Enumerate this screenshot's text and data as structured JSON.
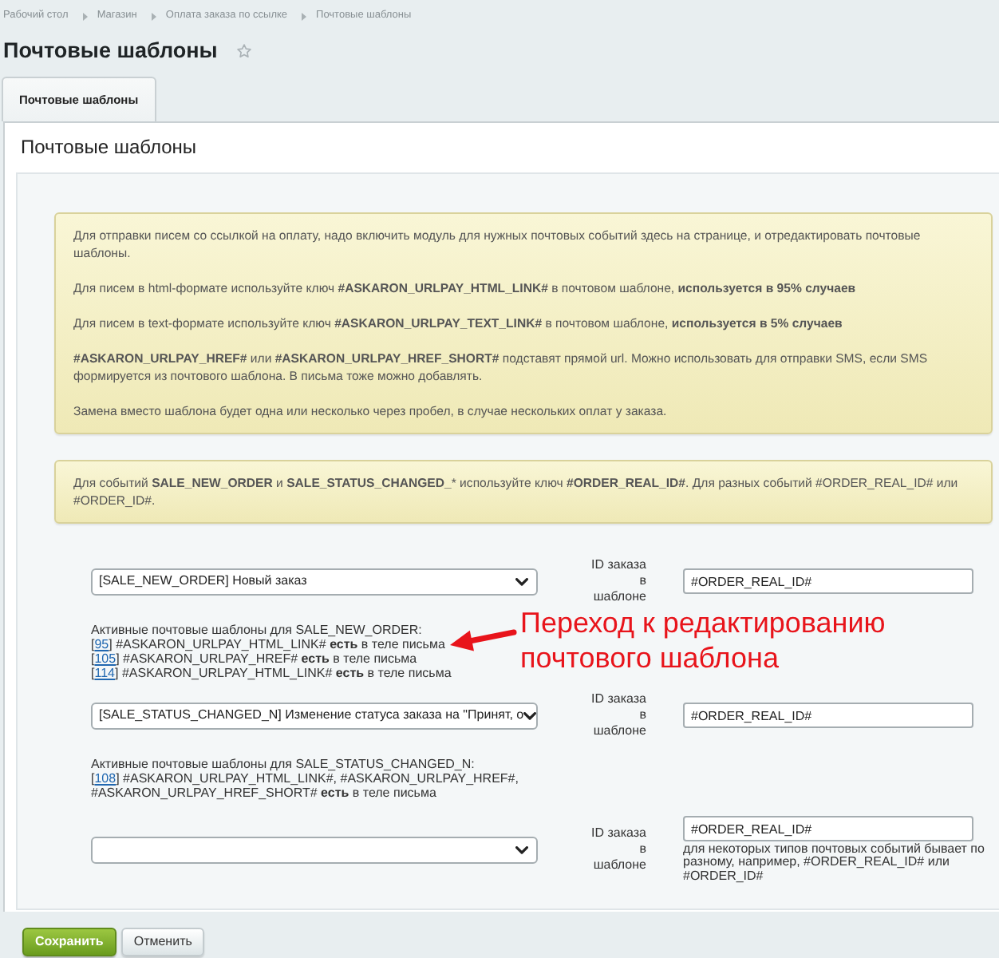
{
  "breadcrumbs": [
    "Рабочий стол",
    "Магазин",
    "Оплата заказа по ссылке",
    "Почтовые шаблоны"
  ],
  "title": "Почтовые шаблоны",
  "tabs": [
    {
      "label": "Почтовые шаблоны",
      "selected": true
    }
  ],
  "section_title": "Почтовые шаблоны",
  "notes": [
    {
      "paragraphs": [
        "Для отправки писем со ссылкой на оплату, надо включить модуль для нужных почтовых событий здесь на странице, и отредактировать почтовые шаблоны.",
        "Для писем в html-формате используйте ключ **#ASKARON_URLPAY_HTML_LINK#** в почтовом шаблоне, **используется в 95% случаев**",
        "Для писем в text-формате используйте ключ **#ASKARON_URLPAY_TEXT_LINK#** в почтовом шаблоне, **используется в 5% случаев**",
        "**#ASKARON_URLPAY_HREF#** или **#ASKARON_URLPAY_HREF_SHORT#** подставят прямой url. Можно использовать для отправки SMS, если SMS формируется из почтового шаблона. В письма тоже можно добавлять.",
        "Замена вместо шаблона будет одна или несколько через пробел, в случае нескольких оплат у заказа."
      ]
    },
    {
      "paragraphs": [
        "Для событий **SALE_NEW_ORDER** и **SALE_STATUS_CHANGED_*** используйте ключ **#ORDER_REAL_ID#**. Для разных событий #ORDER_REAL_ID# или #ORDER_ID#."
      ]
    }
  ],
  "events": [
    {
      "select_value": "[SALE_NEW_ORDER] Новый заказ",
      "id_label": "ID заказа в шаблоне",
      "id_value": "#ORDER_REAL_ID#",
      "active_title": "Активные почтовые шаблоны для SALE_NEW_ORDER:",
      "templates": [
        {
          "before": "[",
          "link": "95",
          "after": "] #ASKARON_URLPAY_HTML_LINK# **есть** в теле письма"
        },
        {
          "before": "[",
          "link": "105",
          "after": "] #ASKARON_URLPAY_HREF# **есть** в теле письма"
        },
        {
          "before": "[",
          "link": "114",
          "after": "] #ASKARON_URLPAY_HTML_LINK# **есть** в теле письма"
        }
      ]
    },
    {
      "select_value": "[SALE_STATUS_CHANGED_N] Изменение статуса заказа на \"Принят, о",
      "id_label": "ID заказа в шаблоне",
      "id_value": "#ORDER_REAL_ID#",
      "active_title": "Активные почтовые шаблоны для SALE_STATUS_CHANGED_N:",
      "templates": [
        {
          "before": "[",
          "link": "108",
          "after": "] #ASKARON_URLPAY_HTML_LINK#, #ASKARON_URLPAY_HREF#, #ASKARON_URLPAY_HREF_SHORT# **есть** в теле письма"
        }
      ]
    },
    {
      "id_label": "ID заказа в шаблоне",
      "id_value": "#ORDER_REAL_ID#",
      "hint": "для некоторых типов почтовых событий бывает по разному, например, #ORDER_REAL_ID# или #ORDER_ID#"
    }
  ],
  "annotation": {
    "text": "Переход к редактированию почтового шаблона"
  },
  "buttons": [
    {
      "label": "Сохранить",
      "kind": "primary"
    },
    {
      "label": "Отменить",
      "kind": "secondary"
    }
  ]
}
